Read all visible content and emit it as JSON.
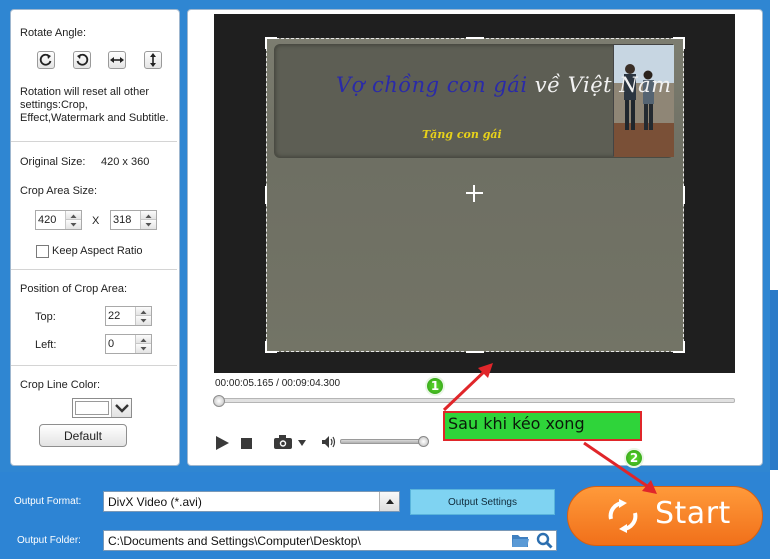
{
  "left_panel": {
    "rotate_label": "Rotate Angle:",
    "rotate_note": [
      "Rotation will reset all other",
      "settings:Crop,",
      "Effect,Watermark and Subtitle."
    ],
    "original_size_label": "Original Size:",
    "original_size_value": "420 x 360",
    "crop_area_size_label": "Crop Area Size:",
    "crop_width": "420",
    "crop_x": "X",
    "crop_height": "318",
    "keep_aspect_label": "Keep Aspect Ratio",
    "keep_aspect_checked": false,
    "position_label": "Position of Crop Area:",
    "top_label": "Top:",
    "top_value": "22",
    "left_label": "Left:",
    "left_value": "0",
    "crop_line_color_label": "Crop Line Color:",
    "crop_line_color": "#ffffff",
    "default_button": "Default"
  },
  "preview": {
    "video_title_blue": "Vợ chồng con gái",
    "video_title_white": "về Việt Nam",
    "video_subtitle": "Tặng con gái",
    "timecode": "00:00:05.165 / 00:09:04.300"
  },
  "bottom": {
    "output_format_label": "Output Format:",
    "output_format_value": "DivX Video (*.avi)",
    "output_settings_button": "Output Settings",
    "output_folder_label": "Output Folder:",
    "output_folder_value": "C:\\Documents and Settings\\Computer\\Desktop\\",
    "start_button": "Start"
  },
  "annotations": {
    "callout_text": "Sau khi kéo xong",
    "badge_1": "1",
    "badge_2": "2"
  },
  "colors": {
    "window_blue": "#2f86d2",
    "start_orange": "#f58a2c",
    "callout_green": "#2fd43a",
    "arrow_red": "#e0262a"
  }
}
